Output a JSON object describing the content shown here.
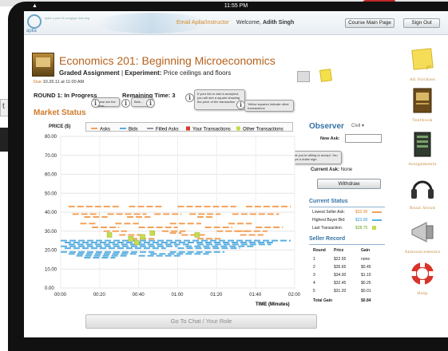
{
  "device": {
    "time": "11:55 PM"
  },
  "desktop": {
    "tab_label": "t"
  },
  "header": {
    "logo": "aplia",
    "subtitle": "aplia a part of cengage learning",
    "link": "Email Aplia/Instructor",
    "welcome_prefix": "Welcome,",
    "user": "Adith Singh",
    "course_home_button": "Course Main Page",
    "sign_out_button": "Sign Out"
  },
  "course": {
    "title": "Economics 201: Beginning Microeconomics",
    "assignment_type": "Graded Assignment",
    "experiment_label": "Experiment:",
    "experiment_name": "Price ceilings and floors",
    "due_label": "Due",
    "due_date": "10.26.11 at 11:00 AM"
  },
  "round": {
    "status": "ROUND 1: In Progress",
    "remaining_label": "Remaining Time: 3"
  },
  "market": {
    "title": "Market Status"
  },
  "tooltips": {
    "offers": "These are the offers...",
    "bids": "Bids...",
    "your_trade": "If your bid or ask is accepted, you will see a square showing the price of the transaction",
    "other_trades": "Yellow squares indicate other transactions",
    "entry": "Enter a price that you're willing to accept. You don't need to type a dollar sign."
  },
  "chart_data": {
    "type": "line",
    "ylabel": "PRICE ($)",
    "xlabel": "TIME (Minutes)",
    "y_ticks": [
      "80.00",
      "70.00",
      "60.00",
      "50.00",
      "40.00",
      "30.00",
      "20.00",
      "10.00",
      "0.00"
    ],
    "x_ticks": [
      "00:00",
      "00:20",
      "00:40",
      "01:00",
      "01:20",
      "01:40",
      "02:00"
    ],
    "ylim": [
      0,
      80
    ],
    "xlim": [
      0,
      120
    ],
    "legend": [
      "Asks",
      "Bids",
      "Filled Asks",
      "Your Transactions",
      "Other Transactions"
    ],
    "colors": {
      "asks": "#f2a25a",
      "bids": "#5aaee0",
      "filled": "#9b8fa8",
      "yours": "#d83a2a",
      "others": "#c7dc4b"
    },
    "series": [
      {
        "name": "Asks",
        "segments": [
          [
            [
              4,
              43
            ],
            [
              30,
              43
            ]
          ],
          [
            [
              35,
              43
            ],
            [
              52,
              43
            ]
          ],
          [
            [
              60,
              43
            ],
            [
              90,
              43
            ]
          ],
          [
            [
              95,
              43
            ],
            [
              118,
              43
            ]
          ],
          [
            [
              6,
              39
            ],
            [
              20,
              39
            ]
          ],
          [
            [
              24,
              39
            ],
            [
              44,
              39
            ]
          ],
          [
            [
              48,
              39
            ],
            [
              62,
              39
            ]
          ],
          [
            [
              66,
              39
            ],
            [
              82,
              39
            ]
          ],
          [
            [
              88,
              39
            ],
            [
              112,
              39
            ]
          ],
          [
            [
              12,
              37.5
            ],
            [
              24,
              37.5
            ]
          ],
          [
            [
              34,
              37.5
            ],
            [
              46,
              37.5
            ]
          ],
          [
            [
              70,
              37.5
            ],
            [
              78,
              37.5
            ]
          ],
          [
            [
              10,
              34
            ],
            [
              18,
              34
            ]
          ],
          [
            [
              28,
              34
            ],
            [
              40,
              34
            ]
          ],
          [
            [
              56,
              34
            ],
            [
              72,
              34
            ]
          ],
          [
            [
              86,
              34
            ],
            [
              98,
              34
            ]
          ],
          [
            [
              16,
              32
            ],
            [
              30,
              32
            ]
          ],
          [
            [
              40,
              32
            ],
            [
              60,
              32
            ]
          ],
          [
            [
              74,
              32
            ],
            [
              88,
              32
            ]
          ],
          [
            [
              100,
              32
            ],
            [
              114,
              32
            ]
          ],
          [
            [
              22,
              30
            ],
            [
              34,
              30
            ]
          ],
          [
            [
              52,
              30
            ],
            [
              64,
              30
            ]
          ],
          [
            [
              80,
              30
            ],
            [
              96,
              30
            ]
          ],
          [
            [
              30,
              28
            ],
            [
              42,
              28
            ]
          ],
          [
            [
              62,
              28
            ],
            [
              74,
              28
            ]
          ],
          [
            [
              92,
              28
            ],
            [
              104,
              28
            ]
          ],
          [
            [
              36,
              26
            ],
            [
              48,
              26
            ]
          ],
          [
            [
              70,
              26
            ],
            [
              82,
              26
            ]
          ],
          [
            [
              56,
              29
            ],
            [
              62,
              29
            ]
          ],
          [
            [
              90,
              30
            ],
            [
              106,
              30
            ]
          ]
        ]
      },
      {
        "name": "Bids",
        "segments": [
          [
            [
              0,
              25
            ],
            [
              118,
              25
            ]
          ],
          [
            [
              2,
              24
            ],
            [
              110,
              24
            ]
          ],
          [
            [
              4,
              23
            ],
            [
              66,
              23
            ]
          ],
          [
            [
              70,
              23
            ],
            [
              108,
              23
            ]
          ],
          [
            [
              0,
              22
            ],
            [
              60,
              22
            ]
          ],
          [
            [
              64,
              22
            ],
            [
              100,
              22
            ]
          ],
          [
            [
              2,
              21
            ],
            [
              54,
              21
            ]
          ],
          [
            [
              60,
              21
            ],
            [
              92,
              21
            ]
          ],
          [
            [
              0,
              19
            ],
            [
              48,
              19
            ]
          ],
          [
            [
              56,
              19
            ],
            [
              84,
              19
            ]
          ],
          [
            [
              4,
              18
            ],
            [
              40,
              18
            ]
          ],
          [
            [
              46,
              18
            ],
            [
              76,
              18
            ]
          ],
          [
            [
              8,
              17
            ],
            [
              34,
              17
            ]
          ],
          [
            [
              40,
              17
            ],
            [
              62,
              17
            ]
          ],
          [
            [
              12,
              16
            ],
            [
              28,
              16
            ]
          ]
        ]
      },
      {
        "name": "Your Transactions",
        "points": []
      },
      {
        "name": "Other Transactions",
        "points": [
          [
            25,
            28
          ],
          [
            36,
            26
          ],
          [
            39,
            24
          ],
          [
            42,
            27
          ],
          [
            47,
            29
          ],
          [
            70,
            28
          ]
        ]
      }
    ]
  },
  "observer": {
    "title": "Observer",
    "select_value": "Civil",
    "new_ask_label": "New Ask:",
    "new_ask_value": "",
    "current_ask_label": "Current Ask:",
    "current_ask_value": "None",
    "withdraw_button": "Withdraw"
  },
  "current_status": {
    "title": "Current Status",
    "rows": [
      {
        "label": "Lowest Seller Ask:",
        "value": "$32.00",
        "color": "#e07b1e"
      },
      {
        "label": "Highest Buyer Bid:",
        "value": "$23.00",
        "color": "#2f8fd0"
      },
      {
        "label": "Last Transaction:",
        "value": "$28.75",
        "color": "#6b9e1e"
      }
    ]
  },
  "seller_record": {
    "title": "Seller Record",
    "headers": [
      "Round",
      "Price",
      "Gain"
    ],
    "rows": [
      [
        "1",
        "$22.55",
        "none"
      ],
      [
        "2",
        "$35.65",
        "$0.45"
      ],
      [
        "3",
        "$34.00",
        "$1.10"
      ],
      [
        "4",
        "$32.45",
        "$0.25"
      ],
      [
        "5",
        "$31.20",
        "$0.01"
      ]
    ],
    "total_label": "Total Gain",
    "total_value": "$0.84"
  },
  "sidebar": [
    {
      "label": "All Stickies",
      "icon": "sticky-note-icon"
    },
    {
      "label": "Textbook",
      "icon": "textbook-icon"
    },
    {
      "label": "Assignments",
      "icon": "assignments-icon"
    },
    {
      "label": "Read Aloud",
      "icon": "headphones-icon"
    },
    {
      "label": "Announcements",
      "icon": "megaphone-icon"
    },
    {
      "label": "Help",
      "icon": "lifebuoy-icon"
    }
  ],
  "chat_button": "Go To Chat / Your Role"
}
